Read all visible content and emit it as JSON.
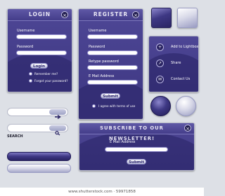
{
  "login": {
    "title": "LOGIN",
    "username_label": "Username",
    "password_label": "Password",
    "button": "Login",
    "remember": "Remember me?",
    "forgot": "Forgot your password?"
  },
  "register": {
    "title": "REGISTER",
    "username_label": "Username",
    "password_label": "Password",
    "retype_label": "Retype password",
    "email_label": "E Mail Address",
    "button": "Submit",
    "terms": "I agree with terms of use"
  },
  "social": {
    "items": [
      {
        "label": "Add to Lightbox",
        "icon": "plus-icon"
      },
      {
        "label": "Share",
        "icon": "share-icon"
      },
      {
        "label": "Contact Us",
        "icon": "mail-icon"
      }
    ]
  },
  "search": {
    "label": "SEARCH"
  },
  "newsletter": {
    "title": "SUBSCRIBE TO OUR NEWSLETTER!",
    "email_label": "E Mail Address",
    "button": "Submit"
  },
  "footer": {
    "credit": "www.shutterstock.com · 59971858"
  },
  "colors": {
    "panel": "#413a86",
    "accent": "#2b2566",
    "background": "#dde0e6"
  }
}
